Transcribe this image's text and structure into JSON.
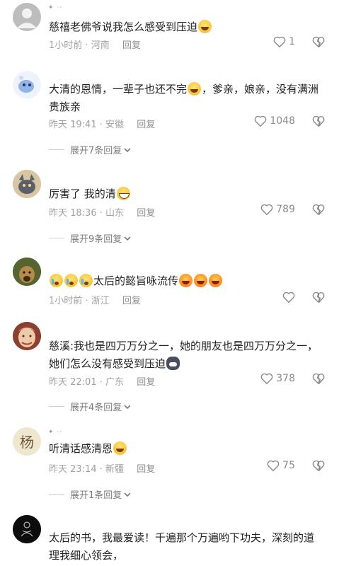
{
  "comments": [
    {
      "text": "慈禧老佛爷说我怎么感受到压迫",
      "time": "1小时前",
      "location": "河南",
      "reply": "回复",
      "likes": "1",
      "expand": ""
    },
    {
      "text": "大清的恩情，一辈子也还不完",
      "text2": "，爹亲，娘亲，没有满洲贵族亲",
      "time": "昨天 19:41",
      "location": "安徽",
      "reply": "回复",
      "likes": "1048",
      "expand": "展开7条回复"
    },
    {
      "text": "厉害了 我的清",
      "time": "昨天 18:36",
      "location": "山东",
      "reply": "回复",
      "likes": "789",
      "expand": "展开9条回复"
    },
    {
      "text": "太后的懿旨咏流传",
      "time": "1小时前",
      "location": "浙江",
      "reply": "回复",
      "likes": "",
      "expand": ""
    },
    {
      "text": "慈溪:我也是四万万分之一，她的朋友也是四万万分之一，她们怎么没有感受到压迫",
      "time": "昨天 22:01",
      "location": "广东",
      "reply": "回复",
      "likes": "378",
      "expand": "展开4条回复"
    },
    {
      "text": "听清话感清恩",
      "time": "昨天 23:14",
      "location": "新疆",
      "reply": "回复",
      "likes": "75",
      "expand": "展开1条回复"
    },
    {
      "text": "太后的书，我最爱读！千遍那个万遍哟下功夫，深刻的道理我细心领会，",
      "time": "",
      "location": "",
      "reply": "",
      "likes": "",
      "expand": ""
    }
  ],
  "separator": "·",
  "icons": {
    "like": "heart-outline-icon",
    "dislike": "broken-heart-icon",
    "expand": "chevron-down-icon"
  },
  "colors": {
    "text": "#222222",
    "meta": "#a0a0a0",
    "link": "#5a6683"
  }
}
